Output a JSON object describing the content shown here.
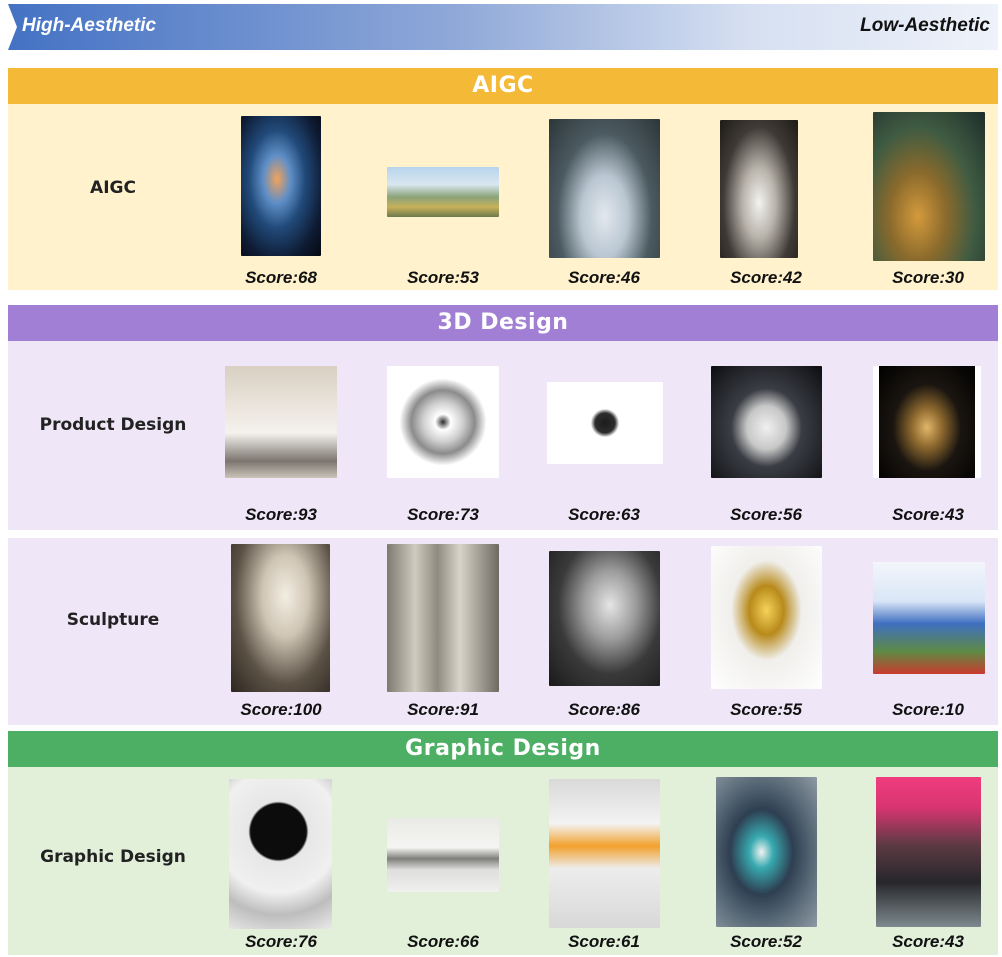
{
  "header": {
    "left_label": "High-Aesthetic",
    "right_label": "Low-Aesthetic"
  },
  "colors": {
    "aigc_header": "#f4b937",
    "aigc_body": "#fff2cd",
    "design3d_header": "#a17fd5",
    "design3d_body": "#efe6f7",
    "graphic_header": "#4caf64",
    "graphic_body": "#e2f0da"
  },
  "sections": {
    "aigc": {
      "title": "AIGC",
      "rows": [
        {
          "label": "AIGC",
          "scores": [
            "Score:68",
            "Score:53",
            "Score:46",
            "Score:42",
            "Score:30"
          ]
        }
      ]
    },
    "design3d": {
      "title": "3D Design",
      "rows": [
        {
          "label": "Product Design",
          "scores": [
            "Score:93",
            "Score:73",
            "Score:63",
            "Score:56",
            "Score:43"
          ]
        },
        {
          "label": "Sculpture",
          "scores": [
            "Score:100",
            "Score:91",
            "Score:86",
            "Score:55",
            "Score:10"
          ]
        }
      ]
    },
    "graphic": {
      "title": "Graphic Design",
      "rows": [
        {
          "label": "Graphic Design",
          "scores": [
            "Score:76",
            "Score:66",
            "Score:61",
            "Score:52",
            "Score:43"
          ]
        }
      ]
    }
  },
  "images": {
    "aigc": [
      "nebula-image",
      "anime-landscape-image",
      "woman-hanbok-image",
      "lotus-figure-image",
      "fantasy-fish-image"
    ],
    "product": [
      "sofa-image",
      "silver-watch-image",
      "black-watch-image",
      "white-car-image",
      "gold-sculpture-lamp-image"
    ],
    "sculpture": [
      "apollo-bust-image",
      "building-statues-image",
      "marble-bust-image",
      "gold-abstract-sculpture-image",
      "blue-monument-image"
    ],
    "graphic": [
      "black-circle-poster-image",
      "product-card-image",
      "exploded-floorplan-image",
      "eye-poster-image",
      "urban-poetry-poster-image"
    ]
  }
}
